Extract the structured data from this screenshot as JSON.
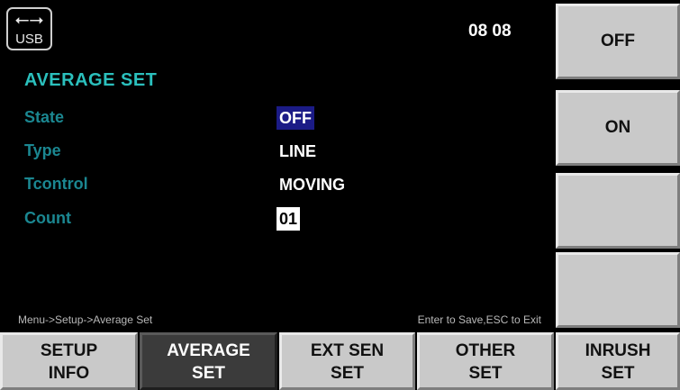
{
  "status_bar": {
    "usb_symbol": "⭠⭢",
    "usb_label": "USB",
    "clock": "08 08"
  },
  "page": {
    "title": "AVERAGE SET"
  },
  "settings": [
    {
      "label": "State",
      "value": "OFF"
    },
    {
      "label": "Type",
      "value": "LINE"
    },
    {
      "label": "Tcontrol",
      "value": "MOVING"
    },
    {
      "label": "Count",
      "value": "01"
    }
  ],
  "footer": {
    "path": "Menu->Setup->Average Set",
    "hint": "Enter to Save,ESC to Exit"
  },
  "side_keys": [
    {
      "label": "OFF"
    },
    {
      "label": "ON"
    },
    {
      "label": ""
    },
    {
      "label": ""
    }
  ],
  "bottom_keys": [
    {
      "line1": "SETUP",
      "line2": "INFO"
    },
    {
      "line1": "AVERAGE",
      "line2": "SET"
    },
    {
      "line1": "EXT SEN",
      "line2": "SET"
    },
    {
      "line1": "OTHER",
      "line2": "SET"
    },
    {
      "line1": "INRUSH",
      "line2": "SET"
    }
  ],
  "colors": {
    "title": "#2bc0bd",
    "label": "#1b8791",
    "selected_bg": "#1b1b86",
    "key_bg": "#c9c9c9",
    "active_key_bg": "#3b3b3b"
  }
}
